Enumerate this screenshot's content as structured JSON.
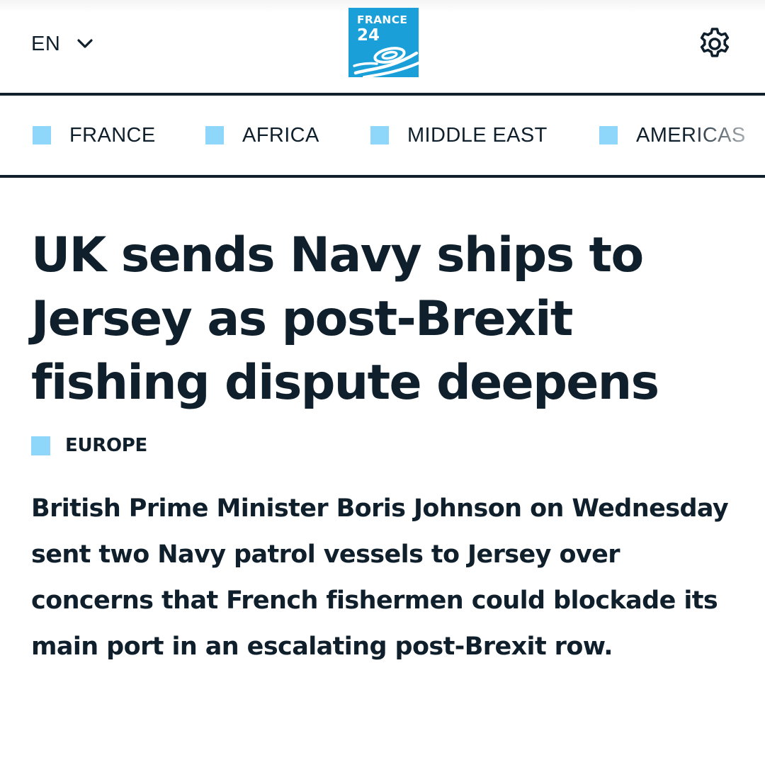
{
  "header": {
    "language": "EN",
    "logo": {
      "line1": "FRANCE",
      "line2": "24"
    },
    "settings_icon": "gear-icon",
    "language_icon": "chevron-down-icon"
  },
  "nav": {
    "items": [
      {
        "label": "FRANCE"
      },
      {
        "label": "AFRICA"
      },
      {
        "label": "MIDDLE EAST"
      },
      {
        "label": "AMERICAS"
      }
    ]
  },
  "article": {
    "headline": "UK sends Navy ships to Jersey as post-Brexit fishing dispute deepens",
    "section": "EUROPE",
    "lede": "British Prime Minister Boris Johnson on Wednesday sent two Navy patrol vessels to Jersey over concerns that French fishermen could blockade its main port in an escalating post-Brexit row."
  },
  "colors": {
    "text": "#0f1f2b",
    "accent_square": "#8fd6fb",
    "logo_background": "#1a9fd9",
    "rule": "#0f1f2b"
  }
}
